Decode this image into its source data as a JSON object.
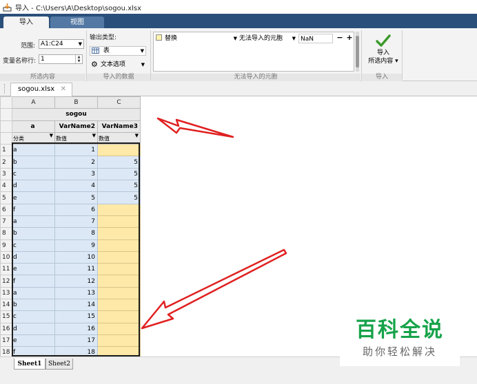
{
  "window": {
    "title": "导入 - C:\\Users\\A\\Desktop\\sogou.xlsx"
  },
  "ribbon_tabs": {
    "import": "导入",
    "view": "视图"
  },
  "selection_group": {
    "range_label": "范围:",
    "range_value": "A1:C24",
    "varname_row_label": "变量名称行:",
    "varname_row_value": "1",
    "footer": "所选内容"
  },
  "output_group": {
    "type_label": "输出类型:",
    "type_value": "表",
    "text_options": "文本选项",
    "footer": "导入的数据"
  },
  "unimportable_group": {
    "replace": "替换",
    "unimportable": "无法导入的元胞",
    "nan": "NaN",
    "minus": "−",
    "plus": "+",
    "footer": "无法导入的元胞"
  },
  "import_group": {
    "button_line1": "导入",
    "button_line2": "所选内容",
    "footer": "导入"
  },
  "document": {
    "tab": "sogou.xlsx"
  },
  "grid": {
    "columns": [
      "A",
      "B",
      "C"
    ],
    "table_title": "sogou",
    "var_names": [
      "a",
      "VarName2",
      "VarName3"
    ],
    "var_types": [
      "分类",
      "数值",
      "数值"
    ],
    "rows": [
      {
        "n": "1",
        "a": "a",
        "b": "1",
        "c": ""
      },
      {
        "n": "2",
        "a": "b",
        "b": "2",
        "c": "5"
      },
      {
        "n": "3",
        "a": "c",
        "b": "3",
        "c": "5"
      },
      {
        "n": "4",
        "a": "d",
        "b": "4",
        "c": "5"
      },
      {
        "n": "5",
        "a": "e",
        "b": "5",
        "c": "5"
      },
      {
        "n": "6",
        "a": "f",
        "b": "6",
        "c": ""
      },
      {
        "n": "7",
        "a": "a",
        "b": "7",
        "c": ""
      },
      {
        "n": "8",
        "a": "b",
        "b": "8",
        "c": ""
      },
      {
        "n": "9",
        "a": "c",
        "b": "9",
        "c": ""
      },
      {
        "n": "10",
        "a": "d",
        "b": "10",
        "c": ""
      },
      {
        "n": "11",
        "a": "e",
        "b": "11",
        "c": ""
      },
      {
        "n": "12",
        "a": "f",
        "b": "12",
        "c": ""
      },
      {
        "n": "13",
        "a": "a",
        "b": "13",
        "c": ""
      },
      {
        "n": "14",
        "a": "b",
        "b": "14",
        "c": ""
      },
      {
        "n": "15",
        "a": "c",
        "b": "15",
        "c": ""
      },
      {
        "n": "16",
        "a": "d",
        "b": "16",
        "c": ""
      },
      {
        "n": "17",
        "a": "e",
        "b": "17",
        "c": ""
      },
      {
        "n": "18",
        "a": "f",
        "b": "18",
        "c": ""
      }
    ]
  },
  "sheets": [
    "Sheet1",
    "Sheet2"
  ],
  "watermark": {
    "main": "百科全说",
    "sub": "助你轻松解决"
  },
  "colors": {
    "annotation_arrow": "#e02020",
    "unimportable_cell": "#ffe9a8",
    "selected_cell": "#dce8f5",
    "ribbon_tab_bar": "#2a4f7a",
    "watermark": "#16a34a"
  }
}
